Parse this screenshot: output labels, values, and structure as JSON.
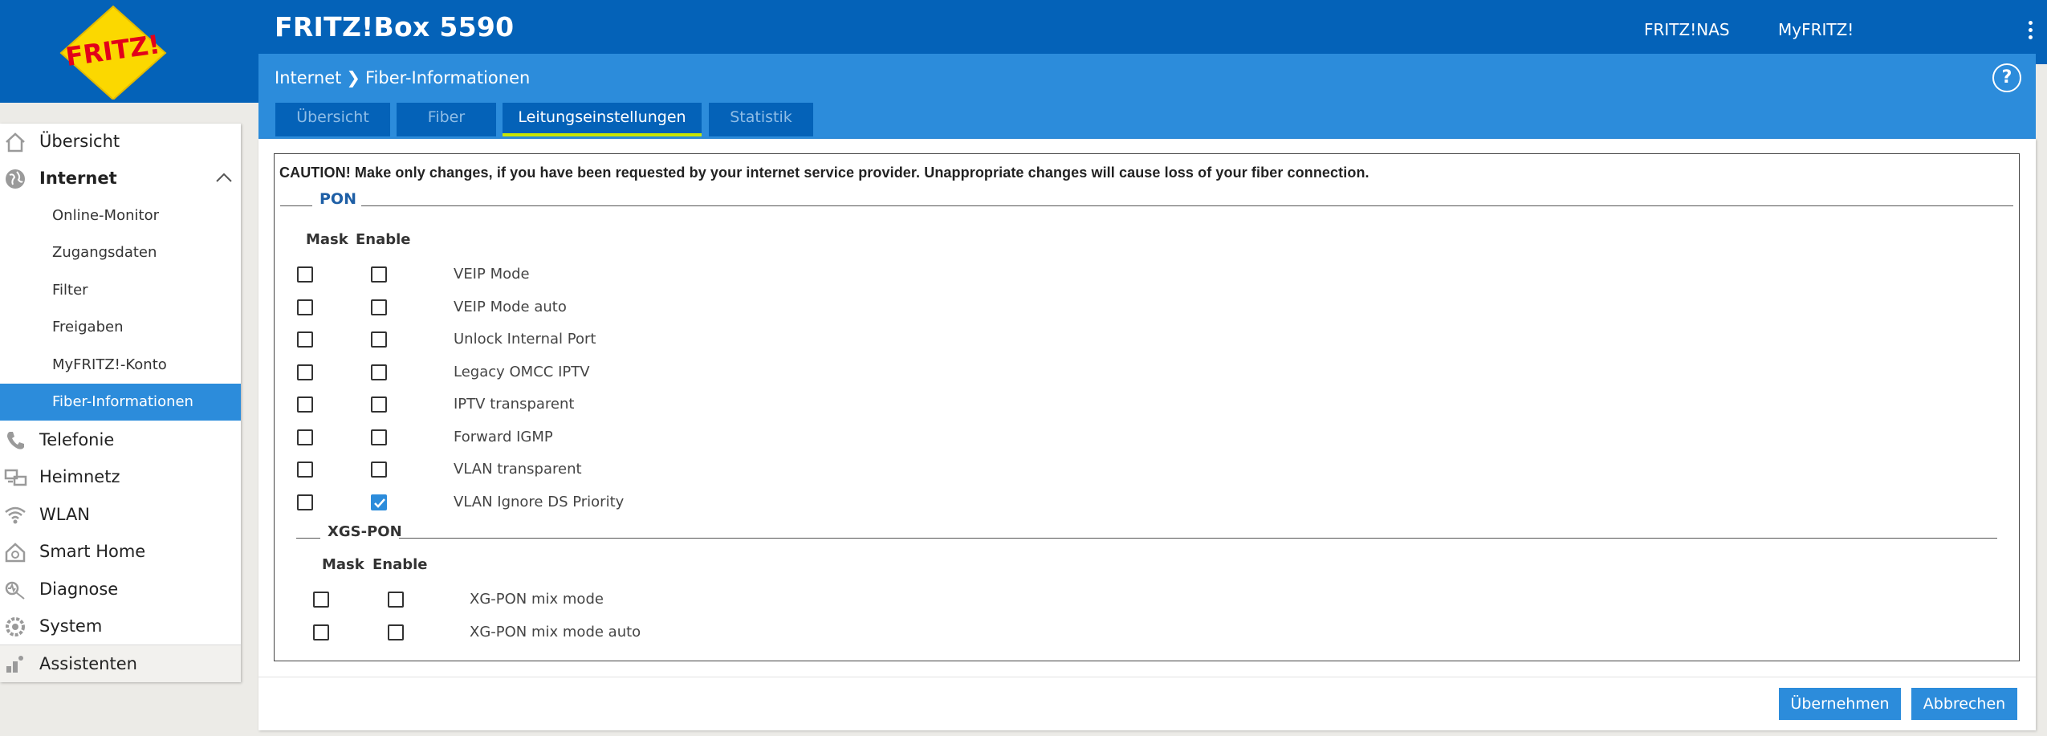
{
  "header": {
    "product": "FRITZ!Box 5590",
    "links": [
      "FRITZ!NAS",
      "MyFRITZ!"
    ],
    "logo_text": "FRITZ!"
  },
  "breadcrumb": {
    "parent": "Internet",
    "current": "Fiber-Informationen"
  },
  "help": "?",
  "tabs": [
    {
      "label": "Übersicht",
      "active": false
    },
    {
      "label": "Fiber",
      "active": false
    },
    {
      "label": "Leitungseinstellungen",
      "active": true
    },
    {
      "label": "Statistik",
      "active": false
    }
  ],
  "sidebar": {
    "items": [
      {
        "label": "Übersicht",
        "icon": "home-icon"
      },
      {
        "label": "Internet",
        "icon": "globe-icon",
        "expanded": true
      },
      {
        "label": "Telefonie",
        "icon": "phone-icon"
      },
      {
        "label": "Heimnetz",
        "icon": "network-icon"
      },
      {
        "label": "WLAN",
        "icon": "wifi-icon"
      },
      {
        "label": "Smart Home",
        "icon": "smart-home-icon"
      },
      {
        "label": "Diagnose",
        "icon": "diagnose-icon"
      },
      {
        "label": "System",
        "icon": "system-icon"
      }
    ],
    "subitems": [
      "Online-Monitor",
      "Zugangsdaten",
      "Filter",
      "Freigaben",
      "MyFRITZ!-Konto",
      "Fiber-Informationen"
    ],
    "selected_subitem": "Fiber-Informationen",
    "assistant": "Assistenten"
  },
  "caution": "CAUTION! Make only changes, if you have been requested by your internet service provider. Unappropriate changes will cause loss of your fiber connection.",
  "pon": {
    "title": "PON",
    "col_mask": "Mask",
    "col_enable": "Enable",
    "options": [
      {
        "label": "VEIP Mode",
        "mask": false,
        "enable": false
      },
      {
        "label": "VEIP Mode auto",
        "mask": false,
        "enable": false
      },
      {
        "label": "Unlock Internal Port",
        "mask": false,
        "enable": false
      },
      {
        "label": "Legacy OMCC IPTV",
        "mask": false,
        "enable": false
      },
      {
        "label": "IPTV transparent",
        "mask": false,
        "enable": false
      },
      {
        "label": "Forward IGMP",
        "mask": false,
        "enable": false
      },
      {
        "label": "VLAN transparent",
        "mask": false,
        "enable": false
      },
      {
        "label": "VLAN Ignore DS Priority",
        "mask": false,
        "enable": true
      }
    ]
  },
  "xgspon": {
    "title": "XGS-PON",
    "col_mask": "Mask",
    "col_enable": "Enable",
    "options": [
      {
        "label": "XG-PON mix mode",
        "mask": false,
        "enable": false
      },
      {
        "label": "XG-PON mix mode auto",
        "mask": false,
        "enable": false
      }
    ]
  },
  "buttons": {
    "apply": "Übernehmen",
    "cancel": "Abbrechen"
  },
  "colors": {
    "header": "#0462b8",
    "accent": "#2c8cdb",
    "tab_underline": "#c8e600"
  }
}
